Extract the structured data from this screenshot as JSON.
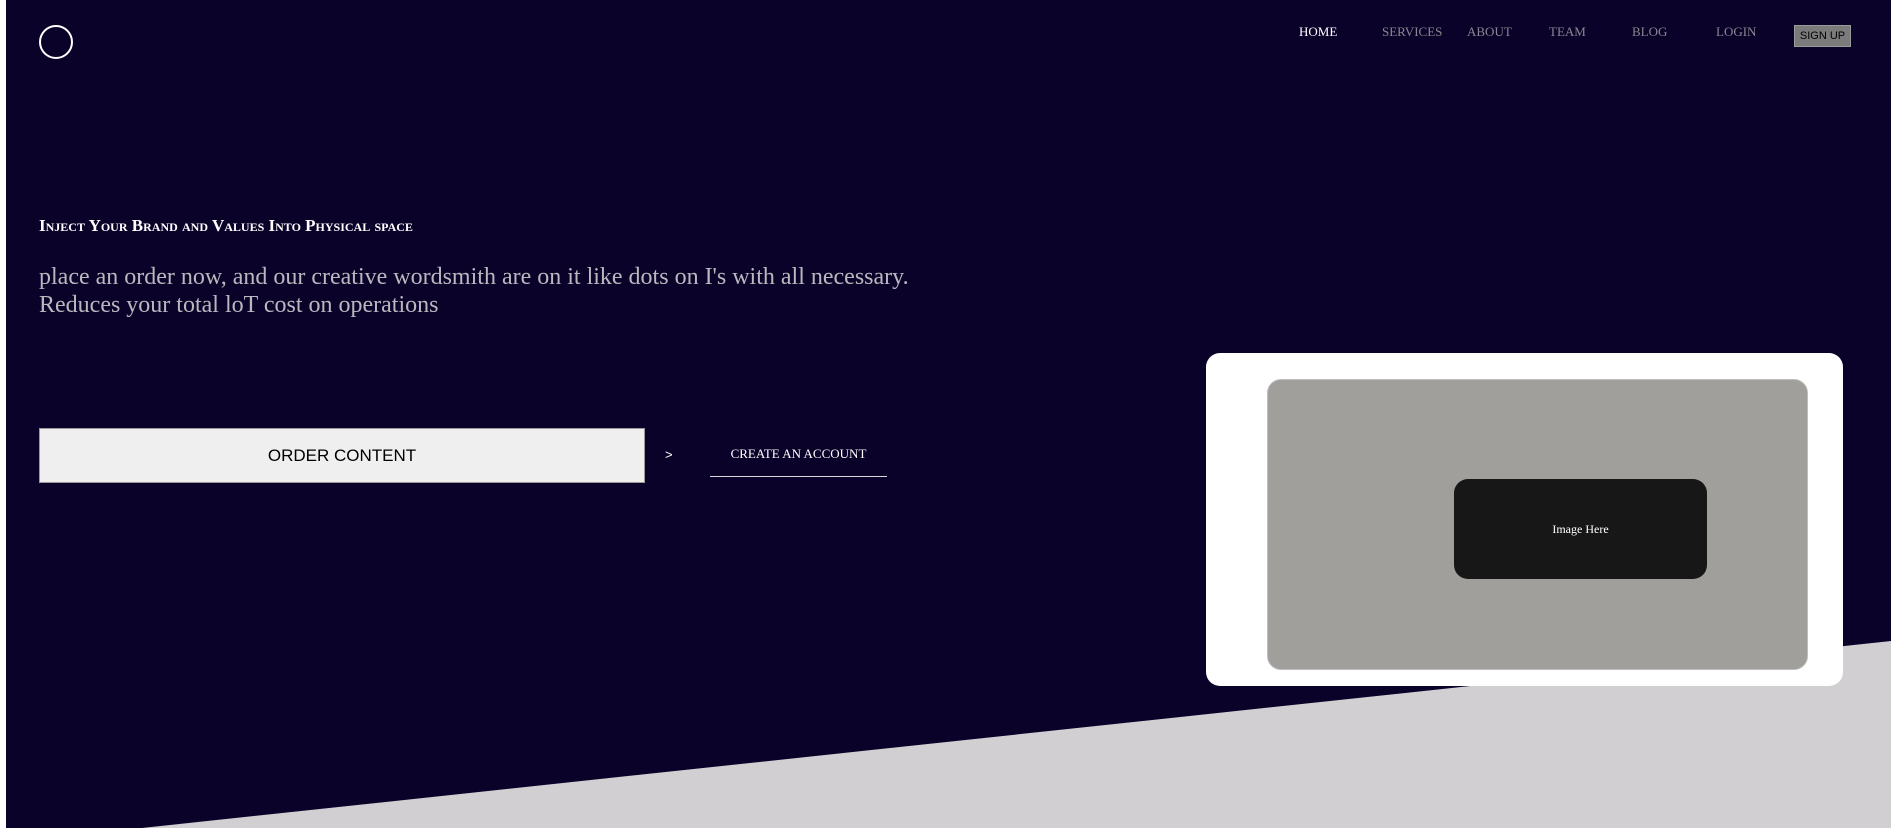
{
  "nav": {
    "items": [
      {
        "label": "HOME",
        "active": true
      },
      {
        "label": "SERVICES",
        "active": false
      },
      {
        "label": "ABOUT",
        "active": false
      },
      {
        "label": "TEAM",
        "active": false
      },
      {
        "label": "BLOG",
        "active": false
      },
      {
        "label": "LOGIN",
        "active": false
      }
    ],
    "signup_label": "SIGN UP"
  },
  "hero": {
    "headline": "Inject Your Brand and Values Into Physical space",
    "subtext_line1": "place an order now, and our creative wordsmith are on it like dots on I's with all necessary.",
    "subtext_line2": "Reduces your total loT cost on operations",
    "order_button_label": "ORDER CONTENT",
    "chevron_label": ">",
    "account_link_label": "CREATE AN ACCOUNT"
  },
  "image_card": {
    "placeholder_label": "Image Here"
  },
  "colors": {
    "background": "#0b0229",
    "wedge": "#d1cfd1",
    "card": "#ffffff",
    "frame": "#a09f9c",
    "tag": "#171717"
  }
}
